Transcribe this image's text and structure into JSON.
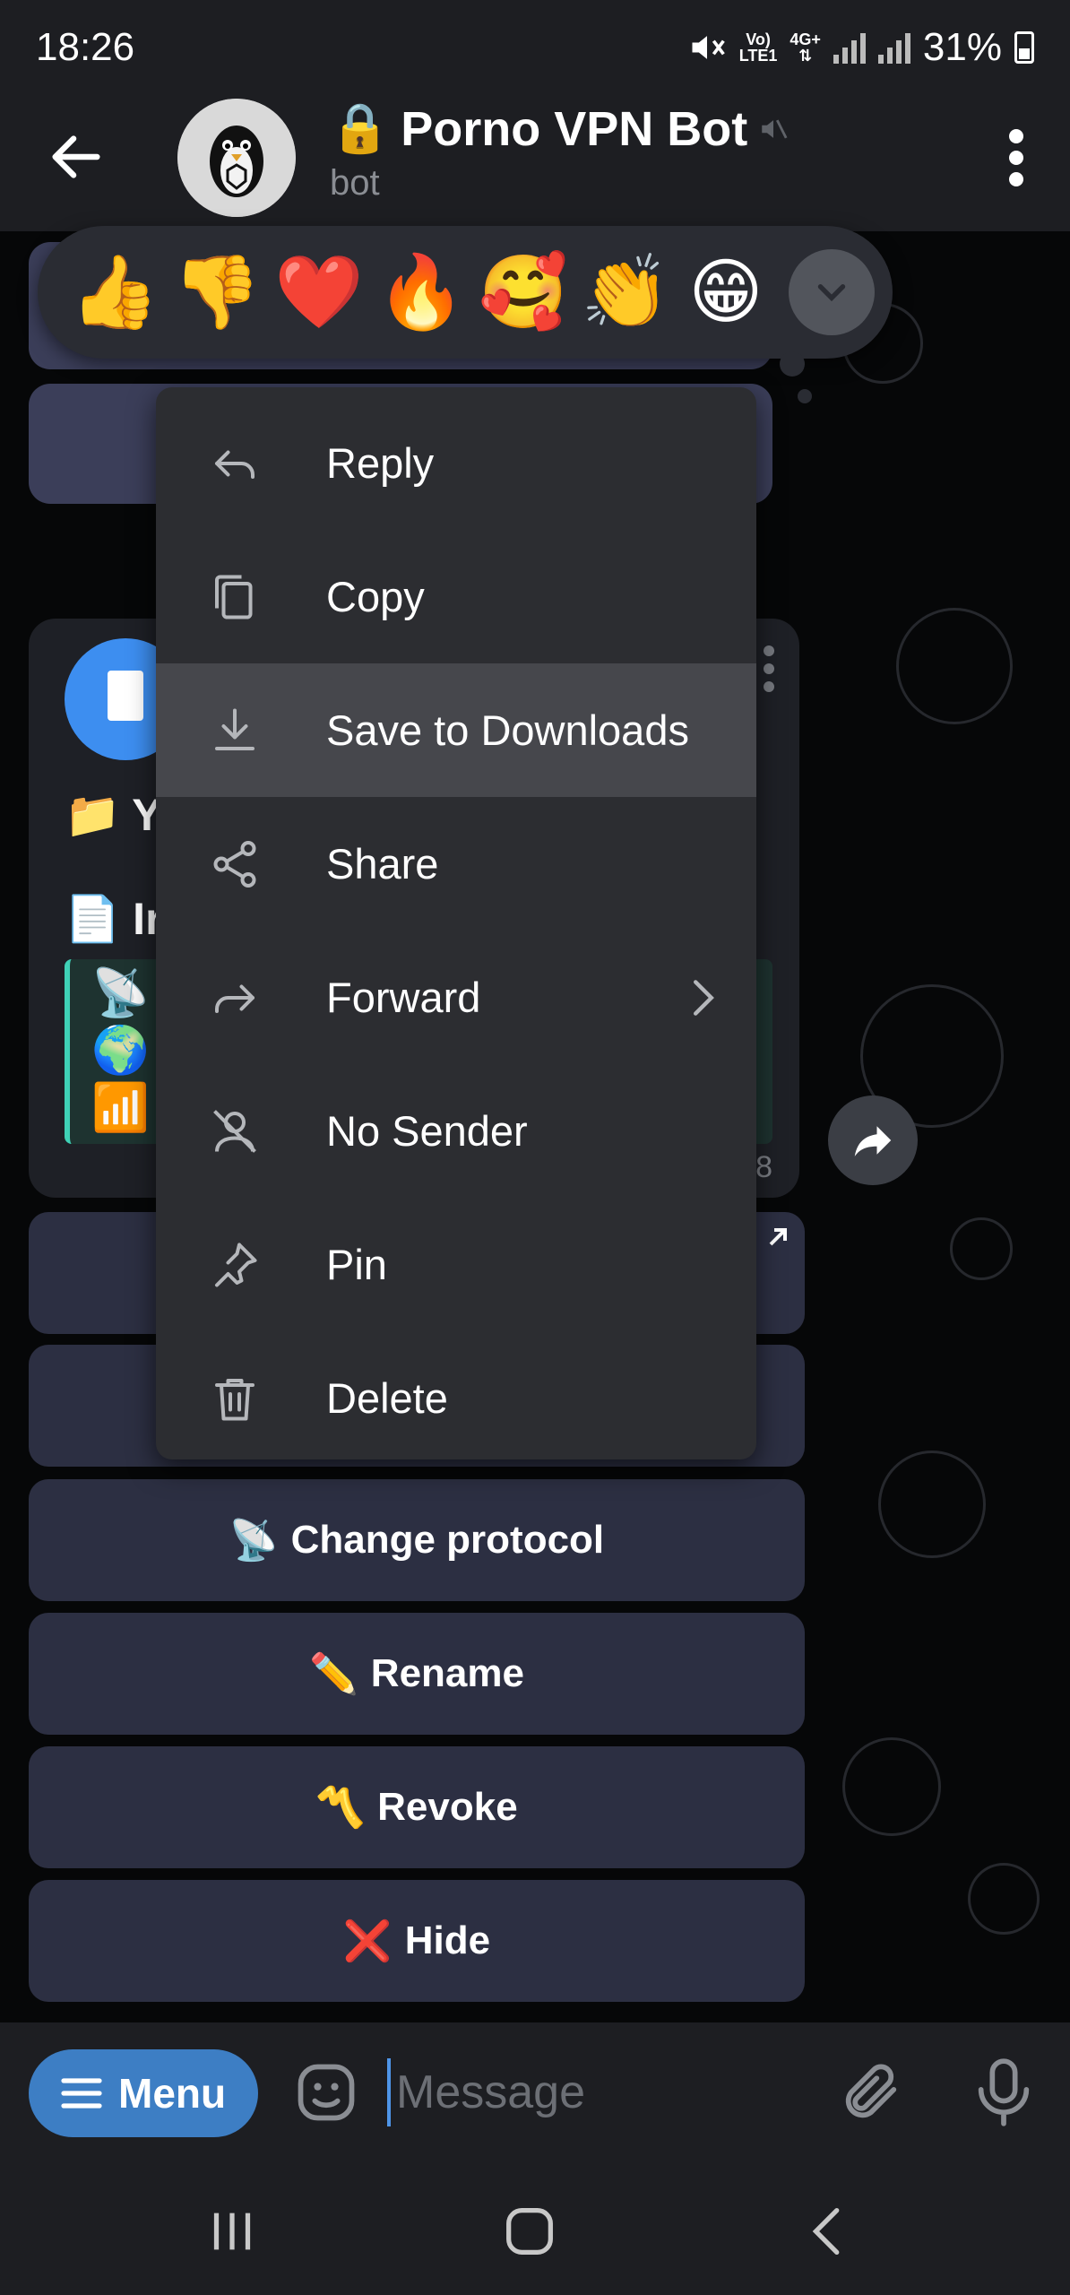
{
  "status_bar": {
    "time": "18:26",
    "network_top": "Vo)",
    "network_bottom": "LTE1",
    "data_top": "4G+",
    "battery": "31%"
  },
  "header": {
    "lock_emoji": "🔒",
    "title": "Porno VPN Bot",
    "subtitle": "bot"
  },
  "reactions": [
    "👍",
    "👎",
    "❤️",
    "🔥",
    "🥰",
    "👏",
    "😁"
  ],
  "message": {
    "line1_emoji": "📁",
    "line1_text": "Y",
    "line2_emoji": "📄",
    "line2_text": "Ir",
    "quote_emojis": [
      "📡",
      "🌍",
      "📶"
    ],
    "time_fragment": "8"
  },
  "context_menu": {
    "items": [
      {
        "label": "Reply",
        "icon": "reply-icon"
      },
      {
        "label": "Copy",
        "icon": "copy-icon"
      },
      {
        "label": "Save to Downloads",
        "icon": "download-icon"
      },
      {
        "label": "Share",
        "icon": "share-icon"
      },
      {
        "label": "Forward",
        "icon": "forward-icon"
      },
      {
        "label": "No Sender",
        "icon": "no-sender-icon"
      },
      {
        "label": "Pin",
        "icon": "pin-icon"
      },
      {
        "label": "Delete",
        "icon": "trash-icon"
      }
    ],
    "highlighted_index": 2
  },
  "keyboard_buttons": [
    {
      "emoji": "📡",
      "label": "Change protocol"
    },
    {
      "emoji": "✏️",
      "label": "Rename"
    },
    {
      "emoji": "〽️",
      "label": "Revoke"
    },
    {
      "emoji": "❌",
      "label": "Hide"
    }
  ],
  "input_bar": {
    "menu_label": "Menu",
    "placeholder": "Message"
  },
  "colors": {
    "accent": "#3d7ec4",
    "menu_bg": "#2c2d31",
    "highlight": "#46474c",
    "keyboard_button": "#2c2f42"
  }
}
